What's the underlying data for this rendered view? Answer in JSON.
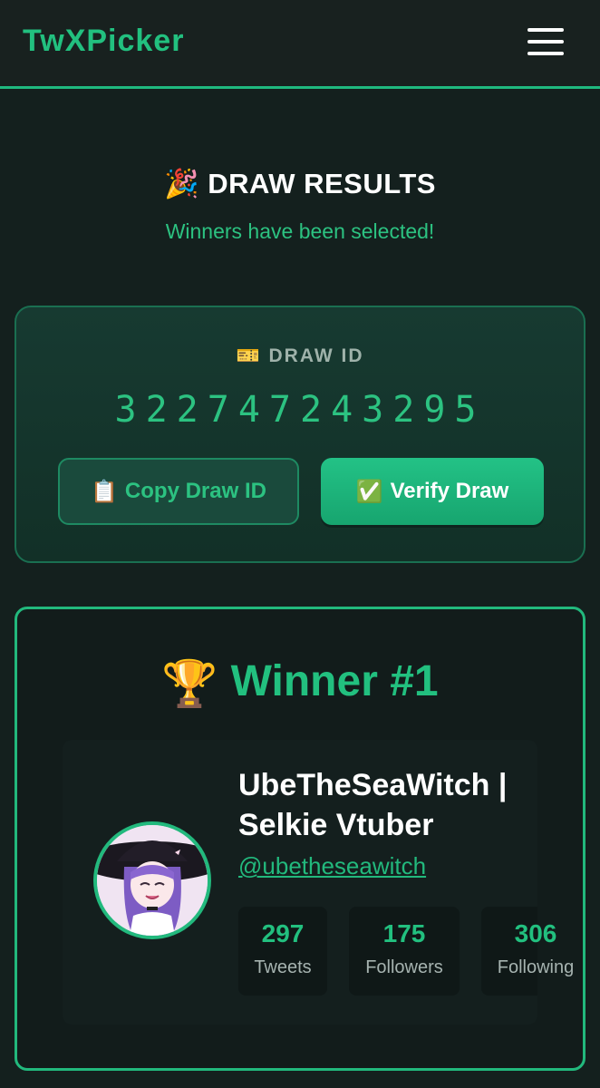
{
  "header": {
    "brand": "TwXPicker",
    "menu_icon": "hamburger-menu-icon"
  },
  "results": {
    "emoji": "🎉",
    "title": "DRAW RESULTS",
    "subtitle": "Winners have been selected!"
  },
  "draw": {
    "label_emoji": "🎫",
    "label": "DRAW ID",
    "id": "322747243295",
    "copy_emoji": "📋",
    "copy_label": "Copy Draw ID",
    "verify_emoji": "✅",
    "verify_label": "Verify Draw"
  },
  "winner": {
    "trophy": "🏆",
    "title": "Winner #1",
    "name": "UbeTheSeaWitch | Selkie Vtuber",
    "handle": "@ubetheseawitch",
    "stats": [
      {
        "value": "297",
        "label": "Tweets"
      },
      {
        "value": "175",
        "label": "Followers"
      },
      {
        "value": "306",
        "label": "Following"
      }
    ]
  },
  "colors": {
    "accent": "#22c07f",
    "background": "#14201e"
  }
}
